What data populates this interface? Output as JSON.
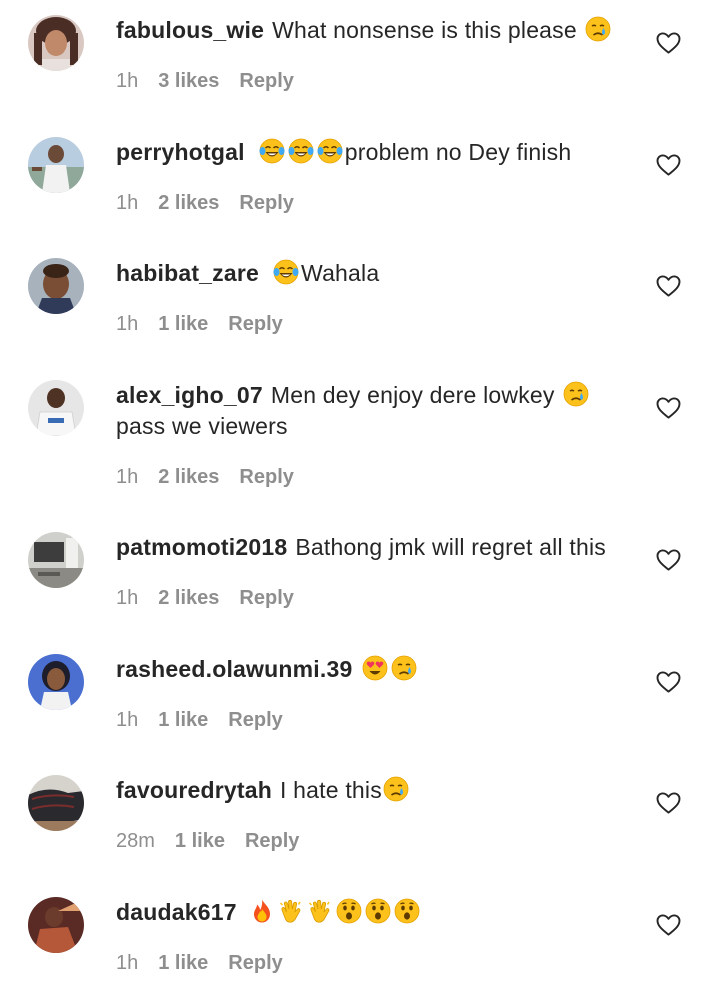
{
  "comments": [
    {
      "username": "fabulous_wie",
      "text": "What nonsense is this please",
      "time": "1h",
      "likes": "3 likes",
      "reply": "Reply"
    },
    {
      "username": "perryhotgal",
      "text": "problem no Dey finish",
      "time": "1h",
      "likes": "2 likes",
      "reply": "Reply"
    },
    {
      "username": "habibat_zare",
      "text": "Wahala",
      "time": "1h",
      "likes": "1 like",
      "reply": "Reply"
    },
    {
      "username": "alex_igho_07",
      "text": "Men dey enjoy dere lowkey",
      "text2": "pass we viewers",
      "time": "1h",
      "likes": "2 likes",
      "reply": "Reply"
    },
    {
      "username": "patmomoti2018",
      "text": "Bathong jmk will regret all this",
      "time": "1h",
      "likes": "2 likes",
      "reply": "Reply"
    },
    {
      "username": "rasheed.olawunmi.39",
      "text": "",
      "time": "1h",
      "likes": "1 like",
      "reply": "Reply"
    },
    {
      "username": "favouredrytah",
      "text": "I hate this",
      "time": "28m",
      "likes": "1 like",
      "reply": "Reply"
    },
    {
      "username": "daudak617",
      "text": "",
      "time": "1h",
      "likes": "1 like",
      "reply": "Reply"
    }
  ],
  "icons": {
    "like": "heart-outline-icon",
    "emoji_cry": "crying-face-emoji",
    "emoji_laugh": "tears-of-joy-emoji",
    "emoji_heart_eyes": "heart-eyes-emoji",
    "emoji_fire": "fire-emoji",
    "emoji_clap": "clapping-hands-emoji",
    "emoji_wow": "astonished-face-emoji"
  },
  "colors": {
    "text": "#262626",
    "meta": "#8e8e8e",
    "background": "#ffffff"
  }
}
